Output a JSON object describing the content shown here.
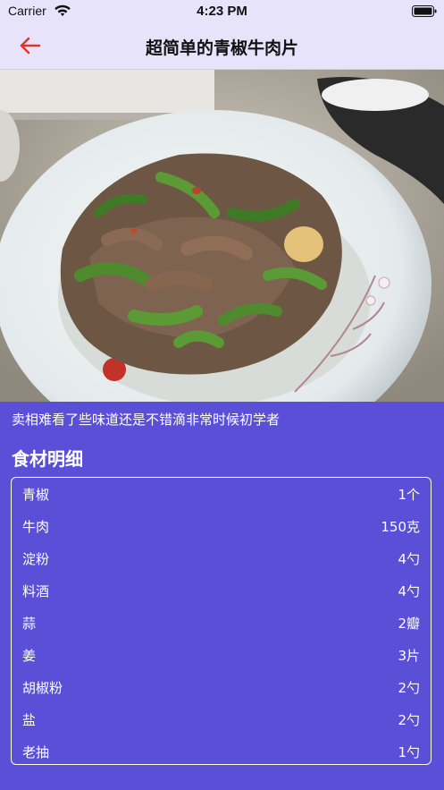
{
  "status_bar": {
    "carrier": "Carrier",
    "time": "4:23 PM"
  },
  "nav": {
    "title": "超简单的青椒牛肉片",
    "back_icon": "arrow-left-icon",
    "back_color": "#e0332b"
  },
  "recipe": {
    "description": "卖相难看了些味道还是不错滴非常时候初学者",
    "ingredients_title": "食材明细",
    "ingredients": [
      {
        "name": "青椒",
        "amount": "1个"
      },
      {
        "name": "牛肉",
        "amount": "150克"
      },
      {
        "name": "淀粉",
        "amount": "4勺"
      },
      {
        "name": "料酒",
        "amount": "4勺"
      },
      {
        "name": "蒜",
        "amount": "2瓣"
      },
      {
        "name": "姜",
        "amount": "3片"
      },
      {
        "name": "胡椒粉",
        "amount": "2勺"
      },
      {
        "name": "盐",
        "amount": "2勺"
      },
      {
        "name": "老抽",
        "amount": "1勺"
      }
    ]
  },
  "colors": {
    "background": "#5a4fd6",
    "navbar": "#e6e3fb"
  }
}
